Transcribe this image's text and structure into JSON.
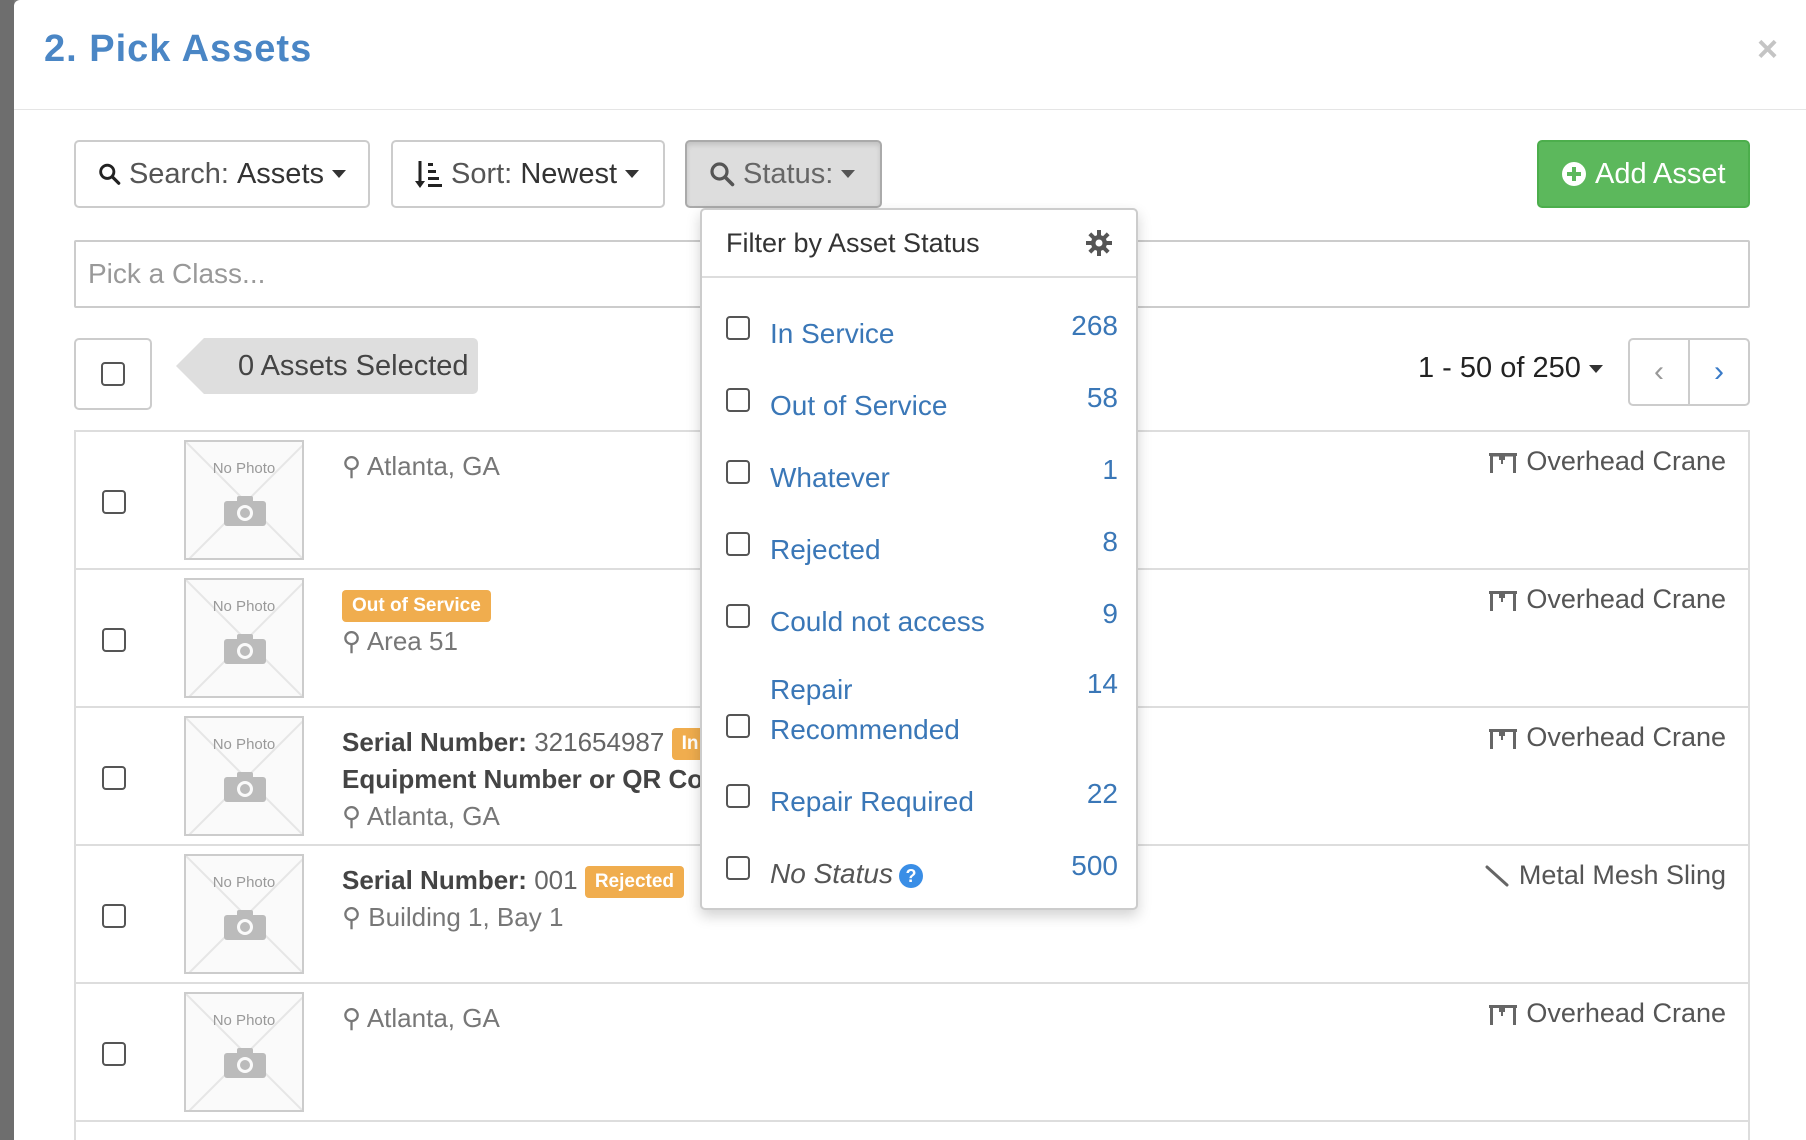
{
  "modal": {
    "title": "2. Pick Assets",
    "close": "×"
  },
  "toolbar": {
    "search_prefix": "Search:",
    "search_value": "Assets",
    "sort_prefix": "Sort:",
    "sort_value": "Newest",
    "status_label": "Status:",
    "add_label": "Add Asset"
  },
  "class_picker": {
    "placeholder": "Pick a Class..."
  },
  "selection": {
    "label": "0 Assets Selected"
  },
  "pager": {
    "range": "1 - 50 of 250",
    "prev": "‹",
    "next": "›"
  },
  "photo_placeholder": "No Photo",
  "assets": [
    {
      "location": "Atlanta, GA",
      "class": "Overhead Crane"
    },
    {
      "badge": "Out of Service",
      "location": "Area 51",
      "class": "Overhead Crane"
    },
    {
      "serial_label": "Serial Number:",
      "serial": "321654987",
      "badge": "In",
      "equipment": "Equipment Number or QR Co",
      "location": "Atlanta, GA",
      "class": "Overhead Crane"
    },
    {
      "serial_label": "Serial Number:",
      "serial": "001",
      "badge": "Rejected",
      "location": "Building 1, Bay 1",
      "class": "Metal Mesh Sling"
    },
    {
      "location": "Atlanta, GA",
      "class": "Overhead Crane"
    }
  ],
  "status_filter": {
    "title": "Filter by Asset Status",
    "items": [
      {
        "label": "In Service",
        "count": "268"
      },
      {
        "label": "Out of Service",
        "count": "58"
      },
      {
        "label": "Whatever",
        "count": "1"
      },
      {
        "label": "Rejected",
        "count": "8"
      },
      {
        "label": "Could not access",
        "count": "9"
      },
      {
        "label": "Repair",
        "label2": "Recommended",
        "count": "14"
      },
      {
        "label": "Repair Required",
        "count": "22"
      },
      {
        "label": "No Status",
        "count": "500"
      }
    ]
  },
  "colors": {
    "title": "#4a86c5",
    "link": "#3a77b7",
    "success": "#5cb85c",
    "warning": "#f0ad4e"
  }
}
